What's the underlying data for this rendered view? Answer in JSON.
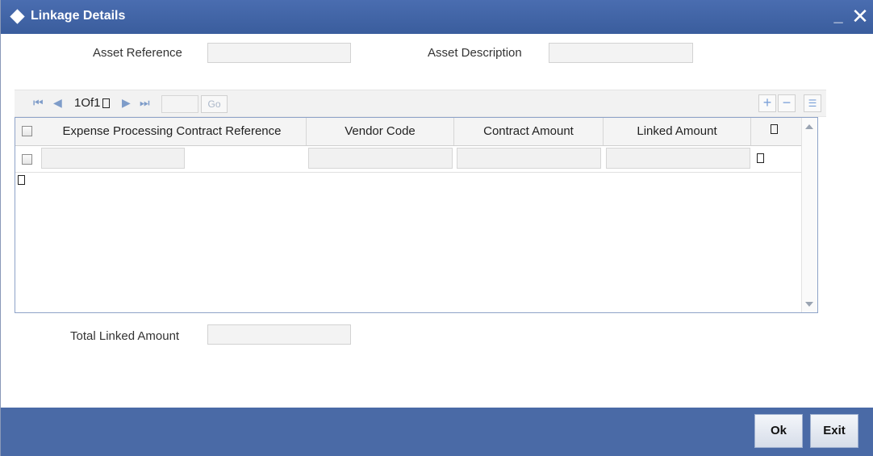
{
  "window": {
    "title": "Linkage Details",
    "minimize_glyph": "_",
    "close_glyph": "✕"
  },
  "form": {
    "asset_reference_label": "Asset Reference",
    "asset_reference_value": "",
    "asset_description_label": "Asset Description",
    "asset_description_value": ""
  },
  "pager": {
    "text": "1Of1",
    "page_value": "",
    "go_label": "Go",
    "first_glyph": "⏮",
    "prev_glyph": "◀",
    "next_glyph": "▶",
    "last_glyph": "⏭",
    "add_glyph": "+",
    "remove_glyph": "−",
    "view_glyph": "☰"
  },
  "grid": {
    "columns": [
      "Expense Processing Contract Reference",
      "Vendor Code",
      "Contract Amount",
      "Linked Amount"
    ],
    "rows": [
      {
        "contract_reference": "",
        "vendor_code": "",
        "contract_amount": "",
        "linked_amount": ""
      }
    ]
  },
  "totals": {
    "total_linked_amount_label": "Total Linked Amount",
    "total_linked_amount_value": ""
  },
  "buttons": {
    "ok_label": "Ok",
    "exit_label": "Exit"
  },
  "colors": {
    "title_bar": "#3f63a3",
    "footer": "#4a6aa6",
    "accent_icon": "#7aa0d8"
  }
}
